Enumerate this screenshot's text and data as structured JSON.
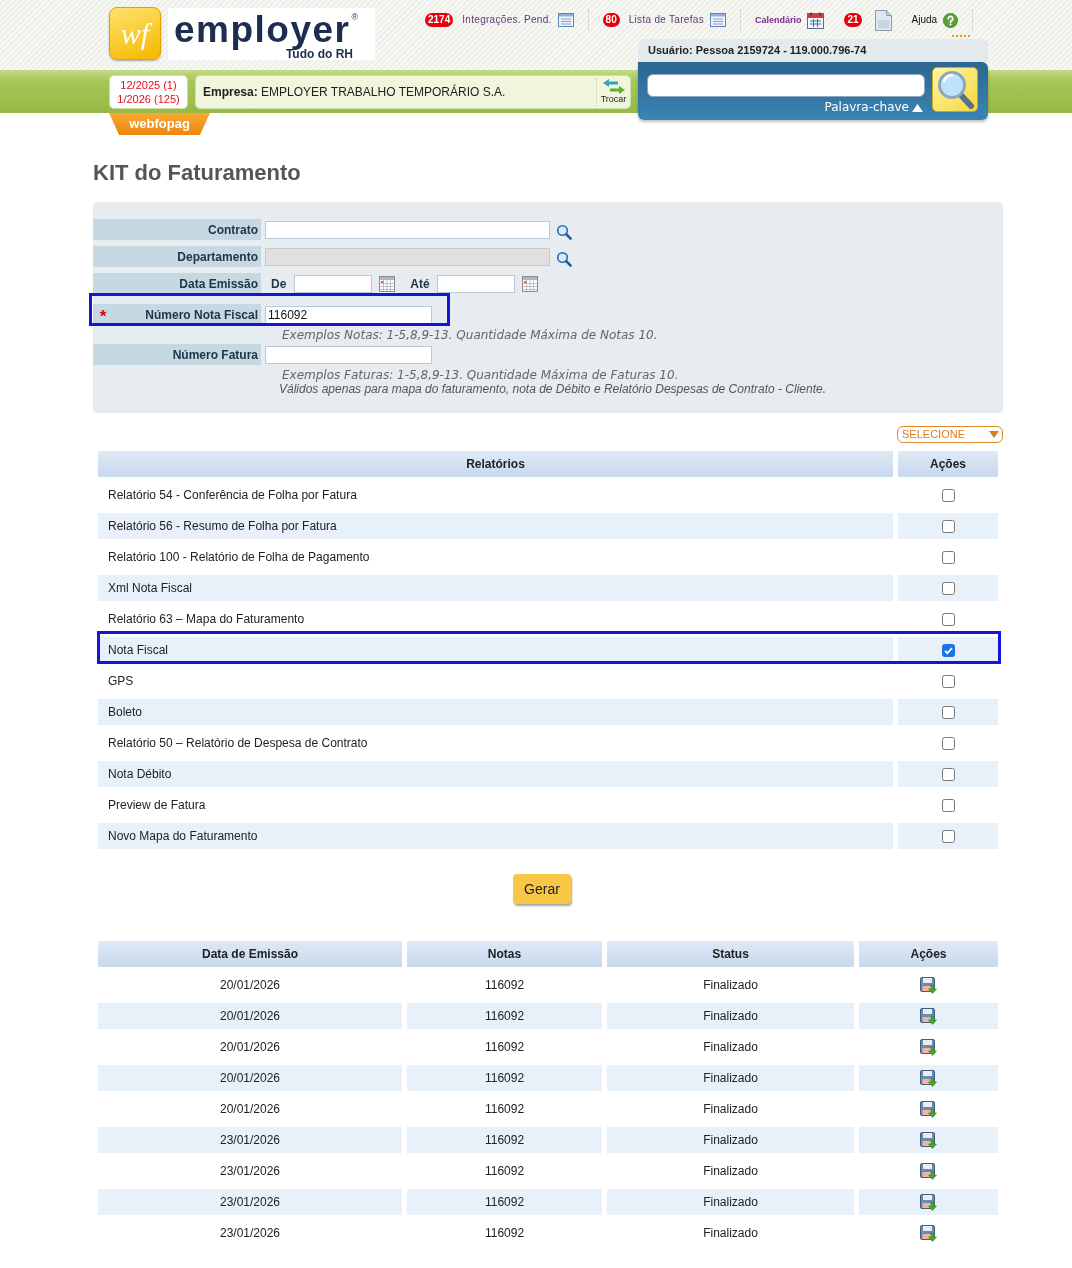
{
  "header": {
    "logo": {
      "mark": "wf",
      "wordmark": "employer",
      "registered": "®",
      "tagline": "Tudo do RH"
    },
    "nav_groups": [
      {
        "items": [
          {
            "kind": "list",
            "badge": "2174",
            "label": "Integrações. Pend."
          }
        ]
      },
      {
        "items": [
          {
            "kind": "list",
            "badge": "80",
            "label": "Lista de Tarefas"
          }
        ]
      },
      {
        "items": [
          {
            "kind": "calendar",
            "label": "Calendário"
          },
          {
            "kind": "document",
            "badge": "21"
          },
          {
            "kind": "help",
            "label": "Ajuda"
          }
        ]
      }
    ],
    "period": [
      "12/2025 (1)",
      "1/2026 (125)"
    ],
    "company": {
      "text": "**Empresa:** EMPLOYER TRABALHO TEMPORÁRIO S.A.",
      "switch_label": "Trocar"
    },
    "system_tab": "webfopag",
    "user_info": "Usuário: Pessoa 2159724 - 119.000.796-74",
    "search": {
      "toggle_label": "Palavra-chave"
    }
  },
  "page_title": "KIT do Faturamento",
  "form": {
    "required_mark": "*",
    "fields": [
      {
        "kind": "lookup",
        "label": "Contrato",
        "required": false,
        "disabled": false,
        "highlighted": false
      },
      {
        "kind": "lookup",
        "label": "Departamento",
        "required": false,
        "disabled": true,
        "highlighted": false
      },
      {
        "kind": "date_range",
        "label": "Data Emissão",
        "from_label": "De",
        "to_label": "Até",
        "required": false,
        "disabled": false,
        "highlighted": false
      },
      {
        "kind": "text",
        "label": "Número Nota Fiscal",
        "value": "116092",
        "required": true,
        "disabled": false,
        "highlighted": true,
        "hints": [
          {
            "kind": "example",
            "text": "Exemplos Notas: 1-5,8,9-13. Quantidade Máxima de Notas 10."
          }
        ]
      },
      {
        "kind": "text",
        "label": "Número Fatura",
        "required": false,
        "disabled": false,
        "highlighted": false,
        "hints": [
          {
            "kind": "example",
            "text": "Exemplos Faturas: 1-5,8,9-13. Quantidade Máxima de Faturas 10."
          },
          {
            "kind": "note",
            "text": "Válidos apenas para mapa do faturamento, nota de Débito e Relatório Despesas de Contrato - Cliente."
          }
        ]
      }
    ]
  },
  "report_filter": {
    "label": "SELECIONE"
  },
  "reports": {
    "columns": [
      "Relatórios",
      "Ações"
    ],
    "rows": [
      {
        "name": "Relatório 54 - Conferência de Folha por Fatura",
        "checked": false,
        "highlighted": false
      },
      {
        "name": "Relatório 56 - Resumo de Folha por Fatura",
        "checked": false,
        "highlighted": false
      },
      {
        "name": "Relatório 100 - Relatório de Folha de Pagamento",
        "checked": false,
        "highlighted": false
      },
      {
        "name": "Xml Nota Fiscal",
        "checked": false,
        "highlighted": false
      },
      {
        "name": "Relatório 63 – Mapa do Faturamento",
        "checked": false,
        "highlighted": false
      },
      {
        "name": "Nota Fiscal",
        "checked": true,
        "highlighted": true
      },
      {
        "name": "GPS",
        "checked": false,
        "highlighted": false
      },
      {
        "name": "Boleto",
        "checked": false,
        "highlighted": false
      },
      {
        "name": "Relatório 50 – Relatório de Despesa de Contrato",
        "checked": false,
        "highlighted": false
      },
      {
        "name": "Nota Débito",
        "checked": false,
        "highlighted": false
      },
      {
        "name": "Preview de Fatura",
        "checked": false,
        "highlighted": false
      },
      {
        "name": "Novo Mapa do Faturamento",
        "checked": false,
        "highlighted": false
      }
    ]
  },
  "generate_button": "Gerar",
  "history": {
    "columns": [
      "Data de Emissão",
      "Notas",
      "Status",
      "Ações"
    ],
    "rows": [
      {
        "date": "20/01/2026",
        "notes": "116092",
        "status": "Finalizado"
      },
      {
        "date": "20/01/2026",
        "notes": "116092",
        "status": "Finalizado"
      },
      {
        "date": "20/01/2026",
        "notes": "116092",
        "status": "Finalizado"
      },
      {
        "date": "20/01/2026",
        "notes": "116092",
        "status": "Finalizado"
      },
      {
        "date": "20/01/2026",
        "notes": "116092",
        "status": "Finalizado"
      },
      {
        "date": "23/01/2026",
        "notes": "116092",
        "status": "Finalizado"
      },
      {
        "date": "23/01/2026",
        "notes": "116092",
        "status": "Finalizado"
      },
      {
        "date": "23/01/2026",
        "notes": "116092",
        "status": "Finalizado"
      },
      {
        "date": "23/01/2026",
        "notes": "116092",
        "status": "Finalizado"
      }
    ]
  }
}
